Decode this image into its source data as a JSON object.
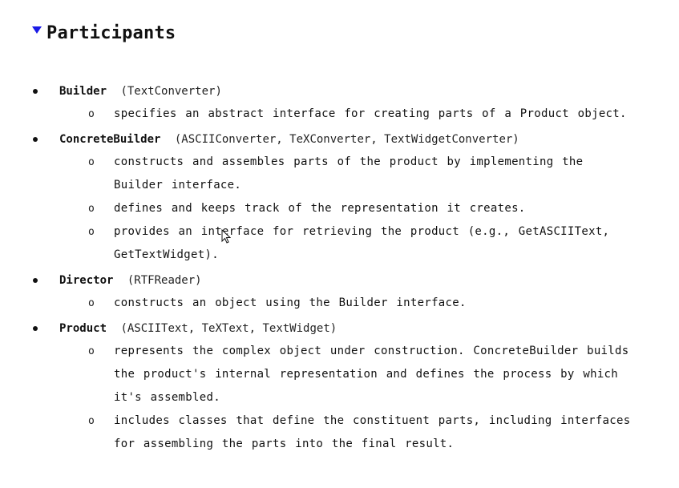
{
  "section": {
    "title": "Participants"
  },
  "participants": [
    {
      "name": "Builder",
      "classes": "(TextConverter)",
      "responsibilities": [
        "specifies an abstract interface for creating parts of a Product object."
      ]
    },
    {
      "name": "ConcreteBuilder",
      "classes": "(ASCIIConverter, TeXConverter, TextWidgetConverter)",
      "responsibilities": [
        "constructs and assembles parts of the product by implementing the Builder interface.",
        "defines and keeps track of the representation it creates.",
        "provides an interface for retrieving the product (e.g., GetASCIIText, GetTextWidget)."
      ]
    },
    {
      "name": "Director",
      "classes": "(RTFReader)",
      "responsibilities": [
        "constructs an object using the Builder interface."
      ]
    },
    {
      "name": "Product",
      "classes": "(ASCIIText, TeXText, TextWidget)",
      "responsibilities": [
        "represents the complex object under construction. ConcreteBuilder builds the product's internal representation and defines the process by which it's assembled.",
        "includes classes that define the constituent parts, including interfaces for assembling the parts into the final result."
      ]
    }
  ],
  "sub_bullet_glyph": "o",
  "icons": {
    "toggle": "collapse-triangle-icon",
    "cursor": "mouse-pointer-icon"
  },
  "colors": {
    "toggle": "#1a1ae6",
    "text": "#111111"
  }
}
